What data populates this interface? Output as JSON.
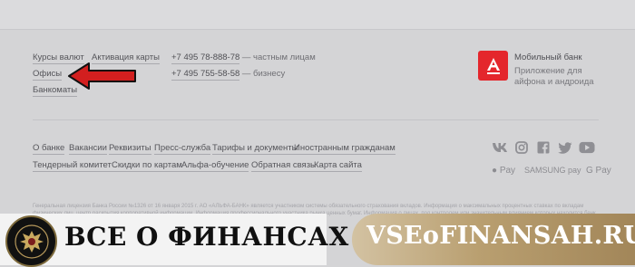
{
  "nav": {
    "col1": [
      "Курсы валют",
      "Офисы",
      "Банкоматы"
    ],
    "col2": [
      "Активация карты"
    ]
  },
  "contacts": [
    {
      "phone": "+7 495 78-888-78",
      "note": "— частным лицам"
    },
    {
      "phone": "+7 495 755-58-58",
      "note": "— бизнесу"
    }
  ],
  "app": {
    "title": "Мобильный банк",
    "desc": "Приложение для айфона и андроида",
    "logo_letter": "А"
  },
  "footer_links_row1": [
    "О банке",
    "Вакансии",
    "Реквизиты",
    "Пресс-служба",
    "Тарифы и документы",
    "Иностранным гражданам"
  ],
  "footer_links_row2": [
    "Тендерный комитет",
    "Скидки по картам",
    "Альфа-обучение",
    "Обратная связь",
    "Карта сайта"
  ],
  "social_icons": [
    "vk-icon",
    "instagram-icon",
    "facebook-icon",
    "twitter-icon",
    "youtube-icon"
  ],
  "payments": [
    "Pay",
    "SAMSUNG pay",
    "G Pay"
  ],
  "fineprint": "Генеральная лицензия Банка России №1326 от 16 января 2015 г. АО «АЛЬФА-БАНК» является участником системы обязательного страхования вкладов. Информация о максимальных процентных ставках по вкладам физических лиц, центр раскрытия корпоративной информации. Информация профессионального участника рынка ценных бумаг. Информация о лицах, под контролем или значительным влиянием которых находится банк. Ул. Каланчевская, 27, Москва, 107078. С целью повышения качества обслуживания",
  "watermark": {
    "left_text": "ВСЕ О ФИНАНСАХ",
    "right_text": "VSEoFINANSAH.RU"
  },
  "colors": {
    "accent": "#e4262c",
    "arrow": "#d21f1f",
    "banner_gold": "#b99f70"
  }
}
